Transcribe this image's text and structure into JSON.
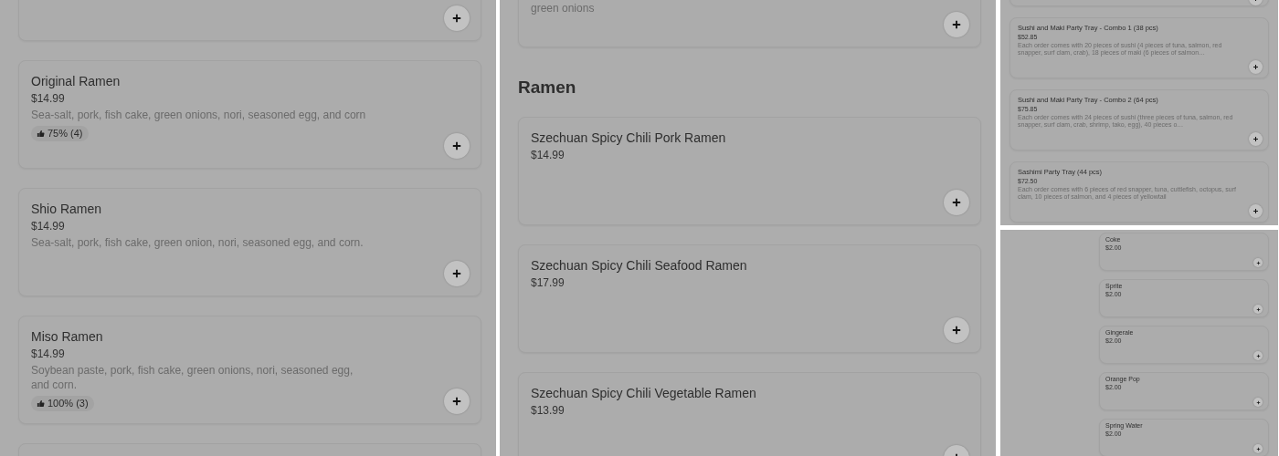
{
  "panels": [
    {
      "kind": "large",
      "items": [
        {
          "kind": "cut"
        },
        {
          "kind": "item",
          "name": "Original Ramen",
          "price": "$14.99",
          "description": "Sea-salt, pork, fish cake, green onions, nori, seasoned egg, and corn",
          "rating": "75% (4)"
        },
        {
          "kind": "item",
          "name": "Shio Ramen",
          "price": "$14.99",
          "description": "Sea-salt, pork, fish cake, green onion, nori, seasoned egg, and corn."
        },
        {
          "kind": "item",
          "name": "Miso Ramen",
          "price": "$14.99",
          "description": "Soybean paste, pork, fish cake, green onions, nori, seasoned egg, and corn.",
          "rating": "100% (3)"
        },
        {
          "kind": "item"
        }
      ]
    },
    {
      "kind": "large",
      "items": [
        {
          "kind": "cut",
          "description": "green onions"
        },
        {
          "kind": "heading",
          "name": "Ramen"
        },
        {
          "kind": "item",
          "name": "Szechuan Spicy Chili Pork Ramen",
          "price": "$14.99"
        },
        {
          "kind": "item",
          "name": "Szechuan Spicy Chili Seafood Ramen",
          "price": "$17.99"
        },
        {
          "kind": "item",
          "name": "Szechuan Spicy Chili Vegetable Ramen",
          "price": "$13.99"
        }
      ]
    },
    {
      "kind": "small",
      "items": [
        {
          "kind": "cut"
        },
        {
          "kind": "item",
          "name": "Sushi and Maki Party Tray - Combo 1 (38 pcs)",
          "price": "$52.85",
          "description": "Each order comes with 20 pieces of sushi (4 pieces of tuna, salmon, red snapper, surf clam, crab), 18 pieces of maki (6 pieces of salmon…"
        },
        {
          "kind": "item",
          "name": "Sushi and Maki Party Tray - Combo 2 (64 pcs)",
          "price": "$75.85",
          "description": "Each order comes with 24 pieces of sushi (three pieces of tuna, salmon, red snapper, surf clam, crab, shrimp, tako, egg), 40 pieces o…"
        },
        {
          "kind": "item",
          "name": "Sashimi Party Tray (44 pcs)",
          "price": "$72.50",
          "description": "Each order comes with 6 pieces of red snapper, tuna, cuttlefish, octopus, surf clam, 10 pieces of salmon, and 4 pieces of yellowtail"
        }
      ]
    },
    {
      "kind": "tiny",
      "items": [
        {
          "kind": "item",
          "name": "Coke",
          "price": "$2.00"
        },
        {
          "kind": "item",
          "name": "Sprite",
          "price": "$2.00"
        },
        {
          "kind": "item",
          "name": "Gingerale",
          "price": "$2.00"
        },
        {
          "kind": "item",
          "name": "Orange Pop",
          "price": "$2.00"
        },
        {
          "kind": "item",
          "name": "Spring Water",
          "price": "$2.00"
        }
      ]
    }
  ]
}
